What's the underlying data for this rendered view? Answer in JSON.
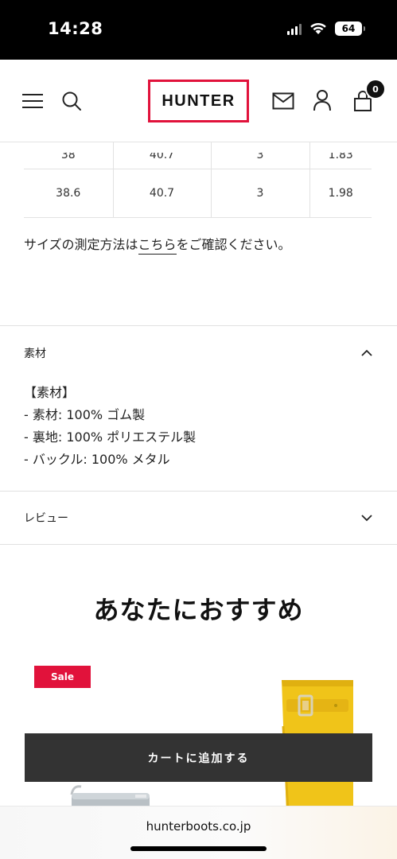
{
  "status_bar": {
    "time": "14:28",
    "battery": "64"
  },
  "header": {
    "logo": "HUNTER",
    "cart_count": "0",
    "logo_border_color": "#e1123b"
  },
  "size_table": {
    "rows": [
      [
        "38",
        "40.7",
        "3",
        "1.83"
      ],
      [
        "38.6",
        "40.7",
        "3",
        "1.98"
      ]
    ]
  },
  "measure_note": {
    "before": "サイズの測定方法は",
    "link": "こちら",
    "after": "をご確認ください。"
  },
  "material": {
    "title": "素材",
    "heading": "【素材】",
    "lines": [
      "- 素材: 100% ゴム製",
      "- 裏地: 100% ポリエステル製",
      "- バックル: 100% メタル"
    ]
  },
  "review": {
    "title": "レビュー"
  },
  "recommendations": {
    "title": "あなたにおすすめ",
    "sale_badge": "Sale",
    "sale_color": "#e1123b"
  },
  "add_to_cart": {
    "label": "カートに追加する"
  },
  "browser": {
    "url": "hunterboots.co.jp"
  }
}
